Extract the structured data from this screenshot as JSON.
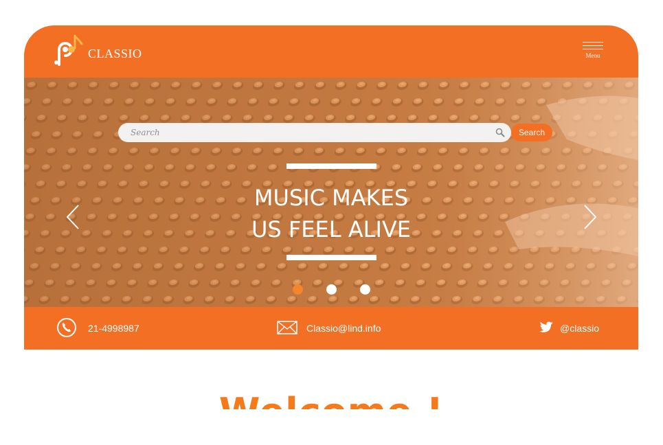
{
  "brand": {
    "name": "CLASSIO",
    "logo_icon": "music-note-logo-icon",
    "accent": "#f36f24"
  },
  "menu": {
    "label": "Menu",
    "icon": "hamburger-icon"
  },
  "search": {
    "placeholder": "Search",
    "button_label": "Search",
    "icon": "search-icon"
  },
  "hero": {
    "title_line1": "MUSIC MAKES",
    "title_line2": "US FEEL ALIVE",
    "prev_icon": "chevron-left-icon",
    "next_icon": "chevron-right-icon",
    "slides": [
      {
        "active": true
      },
      {
        "active": false
      },
      {
        "active": false
      }
    ]
  },
  "contact": {
    "phone": "21-4998987",
    "email": "Classio@lind.info",
    "twitter": "@classio",
    "icons": [
      "phone-icon",
      "mail-icon",
      "twitter-icon"
    ]
  },
  "welcome": {
    "heading": "Welcome !",
    "color": "#f47a1c"
  }
}
